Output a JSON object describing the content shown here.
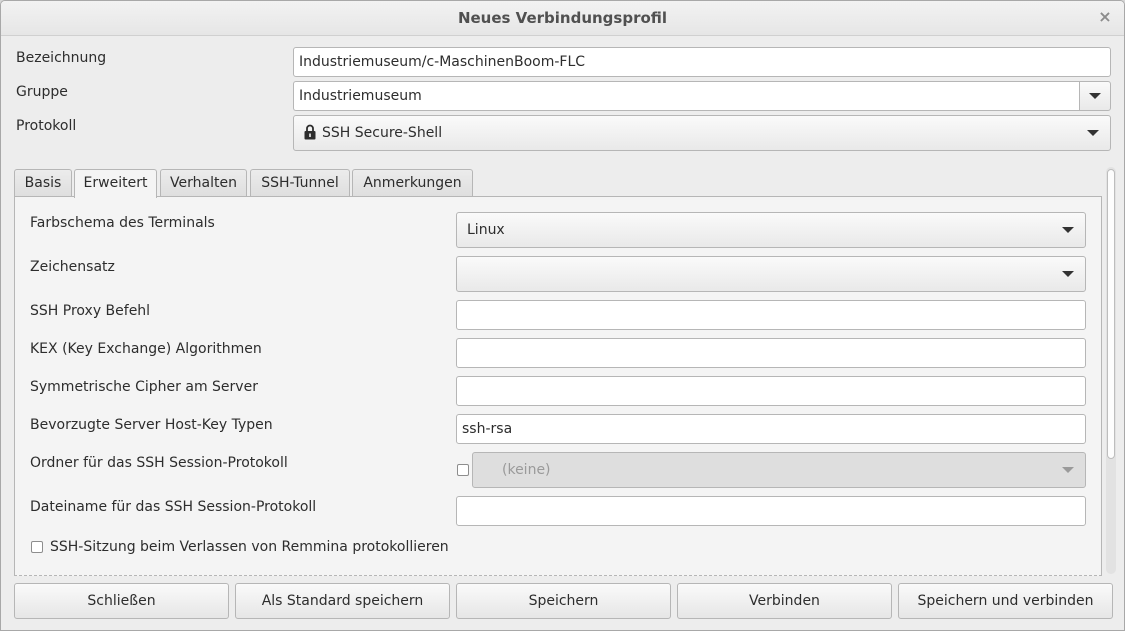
{
  "window": {
    "title": "Neues Verbindungsprofil",
    "close_glyph": "×"
  },
  "form": {
    "name_label": "Bezeichnung",
    "name_value": "Industriemuseum/c-MaschinenBoom-FLC",
    "group_label": "Gruppe",
    "group_value": "Industriemuseum",
    "protocol_label": "Protokoll",
    "protocol_value": "SSH Secure-Shell",
    "protocol_icon": "lock-icon"
  },
  "tabs": [
    {
      "label": "Basis",
      "active": false
    },
    {
      "label": "Erweitert",
      "active": true
    },
    {
      "label": "Verhalten",
      "active": false
    },
    {
      "label": "SSH-Tunnel",
      "active": false
    },
    {
      "label": "Anmerkungen",
      "active": false
    }
  ],
  "advanced": {
    "color_scheme_label": "Farbschema des Terminals",
    "color_scheme_value": "Linux",
    "charset_label": "Zeichensatz",
    "charset_value": "",
    "proxy_label": "SSH Proxy Befehl",
    "proxy_value": "",
    "kex_label": "KEX (Key Exchange) Algorithmen",
    "kex_value": "",
    "cipher_label": "Symmetrische Cipher am Server",
    "cipher_value": "",
    "hostkey_label": "Bevorzugte Server Host-Key Typen",
    "hostkey_value": "ssh-rsa",
    "log_folder_label": "Ordner für das SSH Session-Protokoll",
    "log_folder_value": "(keine)",
    "log_folder_checked": false,
    "log_filename_label": "Dateiname für das SSH Session-Protokoll",
    "log_filename_value": "",
    "log_on_exit_label": "SSH-Sitzung beim Verlassen von Remmina protokollieren",
    "log_on_exit_checked": false
  },
  "buttons": {
    "close": "Schließen",
    "save_default": "Als Standard speichern",
    "save": "Speichern",
    "connect": "Verbinden",
    "save_connect": "Speichern und verbinden"
  },
  "colors": {
    "window_bg": "#ededed",
    "panel_bg": "#f4f4f4",
    "border": "#b6b6b6",
    "text": "#2d2d2d"
  }
}
